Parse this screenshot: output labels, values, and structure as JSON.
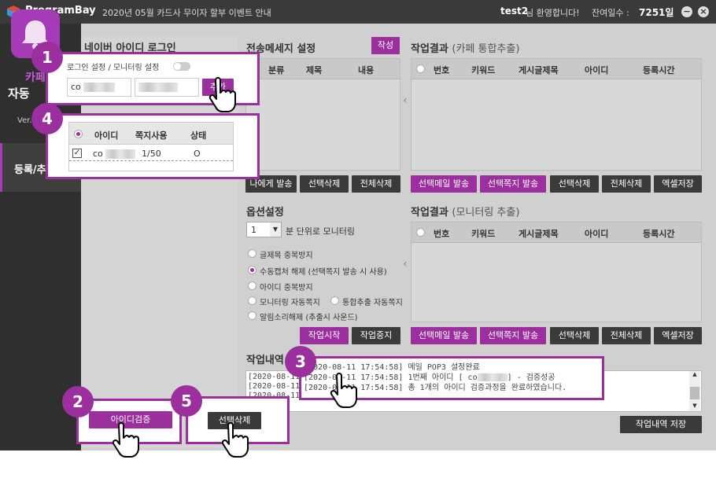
{
  "titlebar": {
    "app_name": "ProgramBay",
    "notice": "2020년 05월 카드사 무이자 할부 이벤트 안내",
    "user_id": "test2",
    "welcome": "님 환영합니다!",
    "days_label": "잔여일수 :",
    "days_value": "7251일",
    "minimize": "−",
    "close": "×"
  },
  "sidebar": {
    "title1": "카페",
    "title2": "자동",
    "version": "Ver.1.0",
    "item_label": "등록/추출"
  },
  "login": {
    "title": "네이버 아이디 로그인",
    "setting_label": "로그인 설정 / 모니터링 설정",
    "id_value": "co",
    "add_button": "추가",
    "verify_button": "아이디검증",
    "delete_button": "선택삭제",
    "table_headers": [
      "아이디",
      "쪽지사용",
      "상태"
    ],
    "rows": [
      {
        "id": "co",
        "usage": "1/50",
        "status": "O"
      }
    ]
  },
  "message": {
    "title": "전송메세지 설정",
    "write_button": "작성",
    "headers": [
      "분류",
      "제목",
      "내용"
    ],
    "buttons": [
      "나에게 발송",
      "선택삭제",
      "전체삭제"
    ]
  },
  "result1": {
    "title": "작업결과",
    "subtitle": "(카페 통합추출)",
    "headers": [
      "번호",
      "키워드",
      "게시글제목",
      "아이디",
      "등록시간"
    ],
    "buttons": [
      "선택메일 발송",
      "선택쪽지 발송",
      "선택삭제",
      "전체삭제",
      "엑셀저장"
    ]
  },
  "options": {
    "title": "옵션설정",
    "interval_value": "1",
    "interval_label": "분 단위로 모니터링",
    "items": [
      "글제목 중복방지",
      "수동캡처 해제 (선택쪽지 발송 시 사용)",
      "아이디 중복방지",
      "모니터링 자동쪽지",
      "통합추출 자동쪽지",
      "알림소리해제 (추출시 사운드)"
    ],
    "start_button": "작업시작",
    "stop_button": "작업중지"
  },
  "result2": {
    "title": "작업결과",
    "subtitle": "(모니터링 추출)",
    "headers": [
      "번호",
      "키워드",
      "게시글제목",
      "아이디",
      "등록시간"
    ],
    "buttons": [
      "선택메일 발송",
      "선택쪽지 발송",
      "선택삭제",
      "전체삭제",
      "엑셀저장"
    ]
  },
  "log": {
    "title": "작업내역",
    "lines_left": [
      "[2020-08-11",
      "[2020-08-11",
      "[2020-08-11"
    ],
    "line1": "[2020-08-11 17:54:58] 메일 POP3 설정완료",
    "line2a": "[2020-08-11 17:54:58] 1번째 아이디 [ co",
    "line2b": "] - 검증성공",
    "line3": "[2020-08-11 17:54:58] 총 1개의 아이디 검증과정을 완료하였습니다.",
    "save_button": "작업내역 저장"
  },
  "badges": [
    "1",
    "2",
    "3",
    "4",
    "5"
  ],
  "colors": {
    "accent": "#9b2f9e",
    "titlebar": "#3a3a3a",
    "sidebar": "#2f2f2f"
  }
}
